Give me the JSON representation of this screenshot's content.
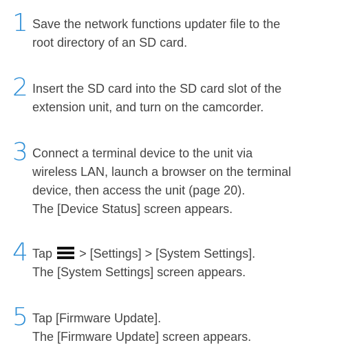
{
  "steps": [
    {
      "number": "1",
      "lines": [
        "Save the network functions updater file to the",
        "root directory of an SD card."
      ]
    },
    {
      "number": "2",
      "lines": [
        "Insert the SD card into the SD card slot of the",
        "extension unit, and turn on the camcorder."
      ]
    },
    {
      "number": "3",
      "lines": [
        "Connect a terminal device to the unit via",
        "wireless LAN, launch a browser on the terminal",
        "device, then access the unit (page 20).",
        "The [Device Status] screen appears."
      ]
    },
    {
      "number": "4",
      "line1_before_icon": "Tap",
      "icon": "menu-icon",
      "line1_after_icon": "> [Settings] > [System Settings].",
      "line2": "The [System Settings] screen appears."
    },
    {
      "number": "5",
      "lines": [
        "Tap [Firmware Update].",
        "The [Firmware Update] screen appears."
      ]
    }
  ],
  "colors": {
    "step_number": "#2f8fd6",
    "body_text": "#444444"
  }
}
